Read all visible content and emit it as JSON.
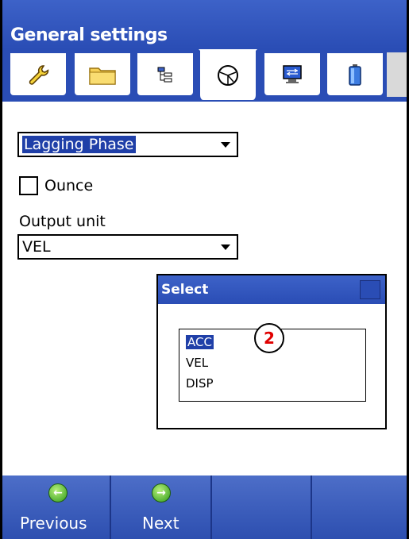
{
  "header": {
    "title": "General settings"
  },
  "tabs": [
    {
      "icon": "wrench-icon"
    },
    {
      "icon": "folder-icon"
    },
    {
      "icon": "tree-icon"
    },
    {
      "icon": "phase-icon",
      "active": true
    },
    {
      "icon": "monitor-icon"
    },
    {
      "icon": "battery-icon"
    }
  ],
  "settings": {
    "phase_select_value": "Lagging Phase",
    "ounce_label": "Ounce",
    "ounce_checked": false,
    "output_unit_label": "Output unit",
    "output_unit_value": "VEL"
  },
  "dialog": {
    "title": "Select",
    "options": [
      "ACC",
      "VEL",
      "DISP"
    ],
    "selected": "ACC"
  },
  "annotation": {
    "badge": "2"
  },
  "bottom_nav": {
    "previous_label": "Previous",
    "next_label": "Next",
    "previous_glyph": "←",
    "next_glyph": "→"
  },
  "colors": {
    "titlebar": "#2a4db5",
    "selection": "#1f3fa8",
    "badge_text": "#e00000",
    "nav_icon": "#2f9a1a"
  }
}
